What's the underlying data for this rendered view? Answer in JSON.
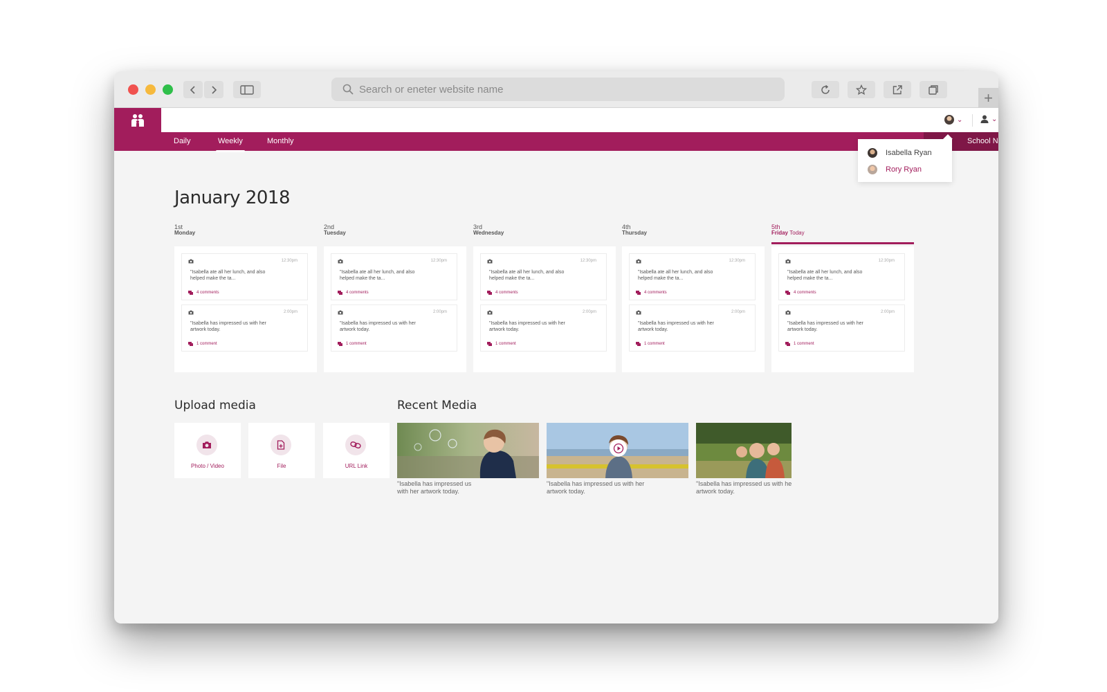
{
  "browser": {
    "search_placeholder": "Search or eneter website name"
  },
  "app": {
    "nav_tabs": [
      "Daily",
      "Weekly",
      "Monthly"
    ],
    "active_tab": "Weekly",
    "school_news": "School Ne",
    "brand_color": "#a21d5c"
  },
  "dropdown": {
    "children": [
      "Isabella Ryan",
      "Rory Ryan"
    ]
  },
  "calendar": {
    "month_title": "January 2018",
    "today_label": "Today",
    "days": [
      {
        "num": "1st",
        "name": "Monday"
      },
      {
        "num": "2nd",
        "name": "Tuesday"
      },
      {
        "num": "3rd",
        "name": "Wednesday"
      },
      {
        "num": "4th",
        "name": "Thursday"
      },
      {
        "num": "5th",
        "name": "Friday"
      }
    ],
    "entries": [
      {
        "time": "12:30pm",
        "quote": "\"Isabella ate all her lunch, and also helped make the ta...",
        "comments": "4 comments"
      },
      {
        "time": "2:00pm",
        "quote": "\"Isabella has impressed us with her artwork today.",
        "comments": "1 comment"
      }
    ]
  },
  "upload": {
    "title": "Upload media",
    "options": [
      "Photo / Video",
      "File",
      "URL Link"
    ]
  },
  "recent": {
    "title": "Recent Media",
    "captions": [
      "\"Isabella has impressed us with her artwork today.",
      "\"Isabella has impressed us with her artwork today.",
      "\"Isabella has impressed us with her artwork today."
    ]
  }
}
